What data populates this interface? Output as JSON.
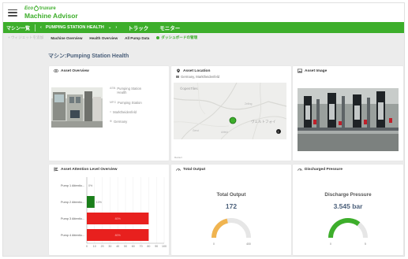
{
  "brand": {
    "logo": "Eco",
    "logo_suffix": "truxure",
    "app_title": "Machine Advisor"
  },
  "nav": {
    "machine_list": "マシン一覧",
    "asset_prev": "‹",
    "asset_name": "PUMPING STATION HEALTH",
    "asset_dropdown": "⌄",
    "asset_next": "›",
    "tabs": [
      {
        "label": "トラック"
      },
      {
        "label": "モニター"
      }
    ]
  },
  "subnav": {
    "add_widget": "+ ウィジェットを追加",
    "items": [
      {
        "label": "Machine Overview"
      },
      {
        "label": "Health Overview"
      },
      {
        "label": "All Pump Data"
      }
    ],
    "dashboard_action": "ダッシュボードの管理"
  },
  "page_title": "マシン:Pumping Station Health",
  "asset_overview": {
    "title": "Asset Overview",
    "fields": [
      {
        "icon": "ASN",
        "value": "Pumping Station Health"
      },
      {
        "icon": "MFG",
        "value": "Pumping Station"
      },
      {
        "icon": "⌂",
        "value": "Marktheidenfeld"
      },
      {
        "icon": "⊕",
        "value": "Germany"
      }
    ]
  },
  "asset_location": {
    "title": "Asset Location",
    "address": "Germany, Marktheidenfeld",
    "map_brand": "©openTiles",
    "map_label": "ヴェルトフォイ",
    "map_footer": "Retract",
    "map_places": [
      "Zelling",
      "Altfeld",
      "Gerst"
    ]
  },
  "asset_image": {
    "title": "Asset Image"
  },
  "attention": {
    "title": "Asset Attention Level Overview",
    "chart_data": {
      "type": "bar",
      "orientation": "horizontal",
      "categories": [
        "Pump 1 Attentio...",
        "Pump 2 Attentio...",
        "Pump 3 Attentio...",
        "Pump 4 Attentio..."
      ],
      "values": [
        0,
        10,
        80,
        80
      ],
      "bar_labels": [
        "0%",
        "10%",
        "80%",
        "80%"
      ],
      "colors": [
        "#1a7f1a",
        "#1a7f1a",
        "#e8201e",
        "#e8201e"
      ],
      "x_ticks": [
        0,
        10,
        20,
        30,
        40,
        50,
        60,
        70,
        80,
        90,
        100
      ],
      "xlim": [
        0,
        100
      ]
    }
  },
  "total_output": {
    "title": "Total Output",
    "gauge_title": "Total Output",
    "value": "172",
    "gauge_fraction": 0.43,
    "min_label": "0",
    "max_label": "400",
    "color": "#f0b450"
  },
  "discharge_pressure": {
    "title": "Discharged Pressure",
    "gauge_title": "Discharge Pressure",
    "value": "3.545 bar",
    "gauge_fraction": 0.71,
    "min_label": "0",
    "max_label": "5",
    "color": "#3dae2b"
  }
}
